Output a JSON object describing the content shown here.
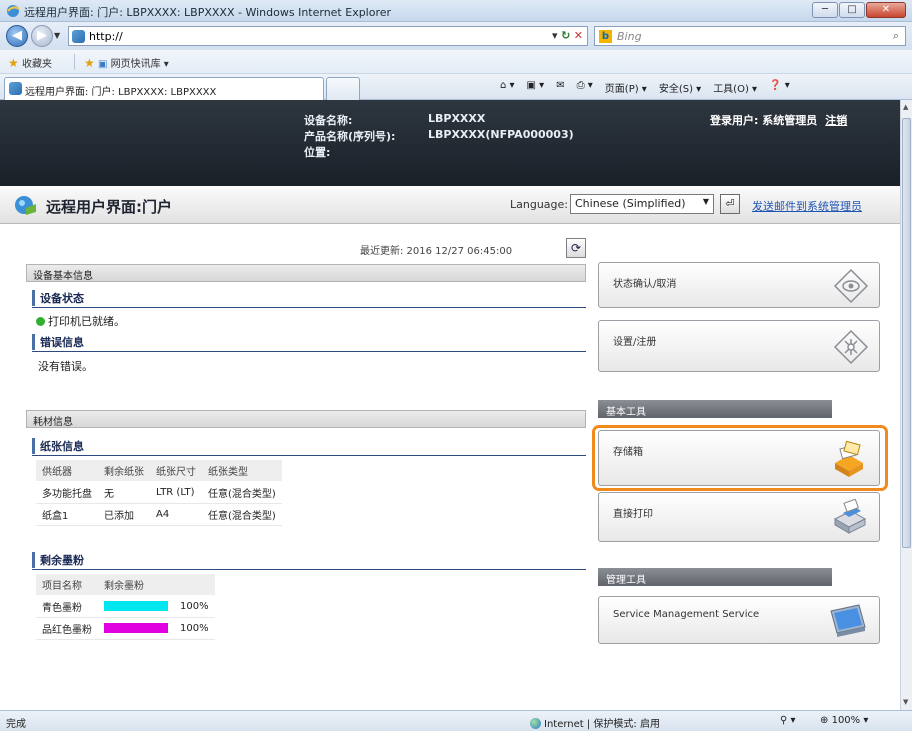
{
  "window": {
    "title": "远程用户界面: 门户: LBPXXXX: LBPXXXX - Windows Internet Explorer",
    "min": "─",
    "max": "□",
    "close": "✕"
  },
  "address": {
    "url": "http://",
    "refresh": "↻",
    "stop": "✕",
    "search_placeholder": "Bing",
    "search_icon": "⌕"
  },
  "favorites": {
    "label": "收藏夹",
    "suggested": "网页快讯库 ▾"
  },
  "tab": {
    "label": "远程用户界面: 门户: LBPXXXX: LBPXXXX"
  },
  "command_bar": {
    "home": "⌂ ▾",
    "feeds": "▣ ▾",
    "mail": "✉",
    "print": "⎙ ▾",
    "page": "页面(P) ▾",
    "safety": "安全(S) ▾",
    "tools": "工具(O) ▾",
    "help": "❓ ▾"
  },
  "header": {
    "device_name_label": "设备名称:",
    "device_name_value": "LBPXXXX",
    "product_name_label": "产品名称(序列号):",
    "product_name_value": "LBPXXXX(NFPA000003)",
    "location_label": "位置:",
    "location_value": "",
    "login_user": "登录用户: 系统管理员",
    "logout": "注销"
  },
  "titlebar": {
    "page_title": "远程用户界面:门户",
    "language_label": "Language:",
    "language_value": "Chinese (Simplified)",
    "send_mail": "发送邮件到系统管理员"
  },
  "status": {
    "last_updated": "最近更新: 2016 12/27 06:45:00",
    "device_basic_info": "设备基本信息",
    "device_status_head": "设备状态",
    "device_status_text": "打印机已就绪。",
    "error_info_head": "错误信息",
    "error_info_text": "没有错误。"
  },
  "consumables": {
    "section": "耗材信息",
    "paper_head": "纸张信息",
    "paper_columns": [
      "供纸器",
      "剩余纸张",
      "纸张尺寸",
      "纸张类型"
    ],
    "paper_rows": [
      [
        "多功能托盘",
        "无",
        "LTR (LT)",
        "任意(混合类型)"
      ],
      [
        "纸盒1",
        "已添加",
        "A4",
        "任意(混合类型)"
      ]
    ],
    "toner_head": "剩余墨粉",
    "toner_columns": [
      "项目名称",
      "剩余墨粉"
    ],
    "toner_rows": [
      {
        "name": "青色墨粉",
        "percent": "100%",
        "color": "#00e5ee",
        "level": 1.0
      },
      {
        "name": "品红色墨粉",
        "percent": "100%",
        "color": "#e000e0",
        "level": 1.0
      }
    ]
  },
  "right": {
    "status_monitor": "状态确认/取消",
    "settings": "设置/注册",
    "basic_tools": "基本工具",
    "mailbox": "存储箱",
    "direct_print": "直接打印",
    "management_tools": "管理工具",
    "sms": "Service Management Service"
  },
  "statusbar": {
    "left": "完成",
    "zone": "Internet | 保护模式: 启用",
    "zoom_tool": "⚲ ▾",
    "zoom": "100%"
  },
  "colors": {
    "highlight": "#f08a1c",
    "header_bg": "#1a2028",
    "cyan_toner": "#00e5ee",
    "magenta_toner": "#e000e0"
  }
}
